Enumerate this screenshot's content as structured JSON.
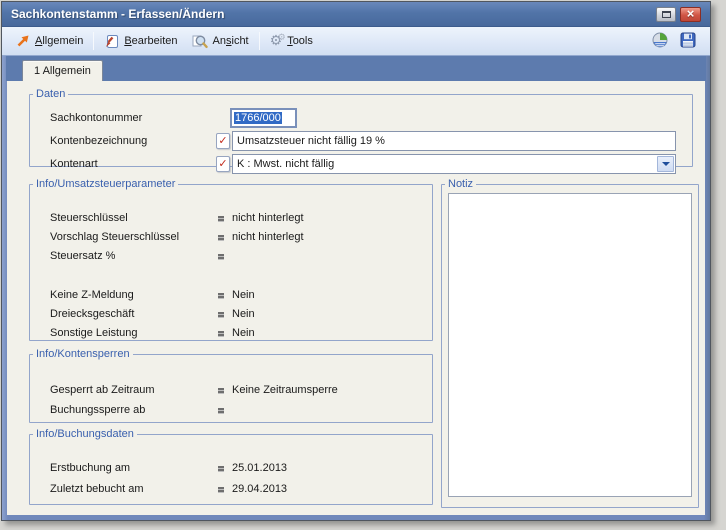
{
  "window": {
    "title": "Sachkontenstamm - Erfassen/Ändern",
    "close_glyph": "×"
  },
  "toolbar": {
    "menu": [
      {
        "pre": "",
        "key": "A",
        "post": "llgemein",
        "icon": "arrow-ne-icon"
      },
      {
        "pre": "",
        "key": "B",
        "post": "earbeiten",
        "icon": "edit-document-icon"
      },
      {
        "pre": "An",
        "key": "s",
        "post": "icht",
        "icon": "magnifier-icon"
      },
      {
        "pre": "",
        "key": "T",
        "post": "ools",
        "icon": "gears-icon"
      }
    ],
    "gear_glyph": "⚙",
    "right_icons": [
      "globe-package-icon",
      "save-icon"
    ]
  },
  "tabs": [
    {
      "label": "1 Allgemein"
    }
  ],
  "groups": {
    "daten": {
      "legend": "Daten",
      "fields": [
        {
          "label": "Sachkontonummer",
          "value": "1766/000",
          "selected": true
        },
        {
          "label": "Kontenbezeichnung",
          "value": "Umsatzsteuer nicht fällig 19 %",
          "check_icon": "✓"
        },
        {
          "label": "Kontenart",
          "value": "K : Mwst. nicht fällig",
          "check_icon": "✓"
        }
      ]
    },
    "umsatzsteuer": {
      "legend": "Info/Umsatzsteuerparameter",
      "rows": [
        {
          "label": "Steuerschlüssel",
          "value": "nicht hinterlegt"
        },
        {
          "label": "Vorschlag Steuerschlüssel",
          "value": "nicht hinterlegt"
        },
        {
          "label": "Steuersatz %",
          "value": ""
        },
        {
          "label": "Keine Z-Meldung",
          "value": "Nein"
        },
        {
          "label": "Dreiecksgeschäft",
          "value": "Nein"
        },
        {
          "label": "Sonstige Leistung",
          "value": "Nein"
        }
      ]
    },
    "kontensperren": {
      "legend": "Info/Kontensperren",
      "rows": [
        {
          "label": "Gesperrt ab Zeitraum",
          "value": "Keine Zeitraumsperre"
        },
        {
          "label": "Buchungssperre ab",
          "value": ""
        }
      ]
    },
    "buchungsdaten": {
      "legend": "Info/Buchungsdaten",
      "rows": [
        {
          "label": "Erstbuchung am",
          "value": "25.01.2013"
        },
        {
          "label": "Zuletzt bebucht am",
          "value": "29.04.2013"
        }
      ]
    },
    "notiz": {
      "legend": "Notiz",
      "value": ""
    }
  },
  "colors": {
    "titlebar": "#4e71a6",
    "frame": "#7088bb",
    "selection": "#316ac5",
    "group_label": "#3a60ae",
    "close_button": "#c94a3a",
    "content_bg": "#f2f1ea"
  }
}
